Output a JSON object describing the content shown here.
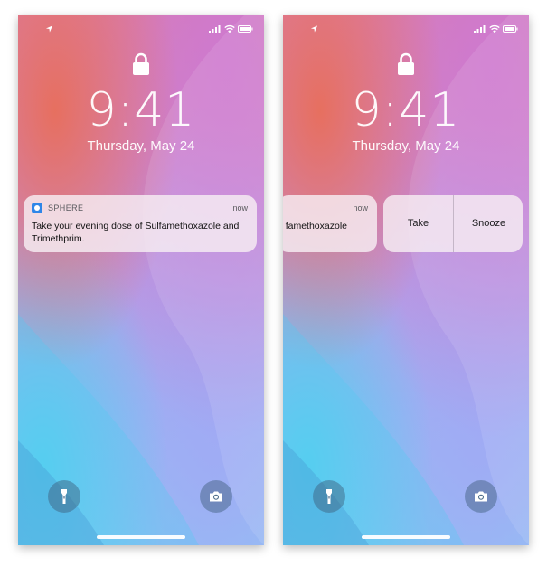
{
  "screens": [
    {
      "time": "9:41",
      "date": "Thursday, May 24",
      "notification": {
        "app": "SPHERE",
        "timestamp": "now",
        "message": "Take your evening dose of Sulfamethoxazole and Trimethprim."
      }
    },
    {
      "time": "9:41",
      "date": "Thursday, May 24",
      "notification": {
        "timestamp": "now",
        "message_visible": "famethoxazole"
      },
      "actions": [
        {
          "label": "Take"
        },
        {
          "label": "Snooze"
        }
      ]
    }
  ],
  "icons": {
    "status": [
      "location-arrow-icon",
      "signal-icon",
      "wifi-icon",
      "battery-icon"
    ],
    "lock": "lock-icon",
    "app": "sphere-app-icon",
    "quick_actions": [
      "flashlight-icon",
      "camera-icon"
    ]
  },
  "colors": {
    "app_icon": "#2f86e8",
    "notification_bg": "#f6eef3"
  }
}
